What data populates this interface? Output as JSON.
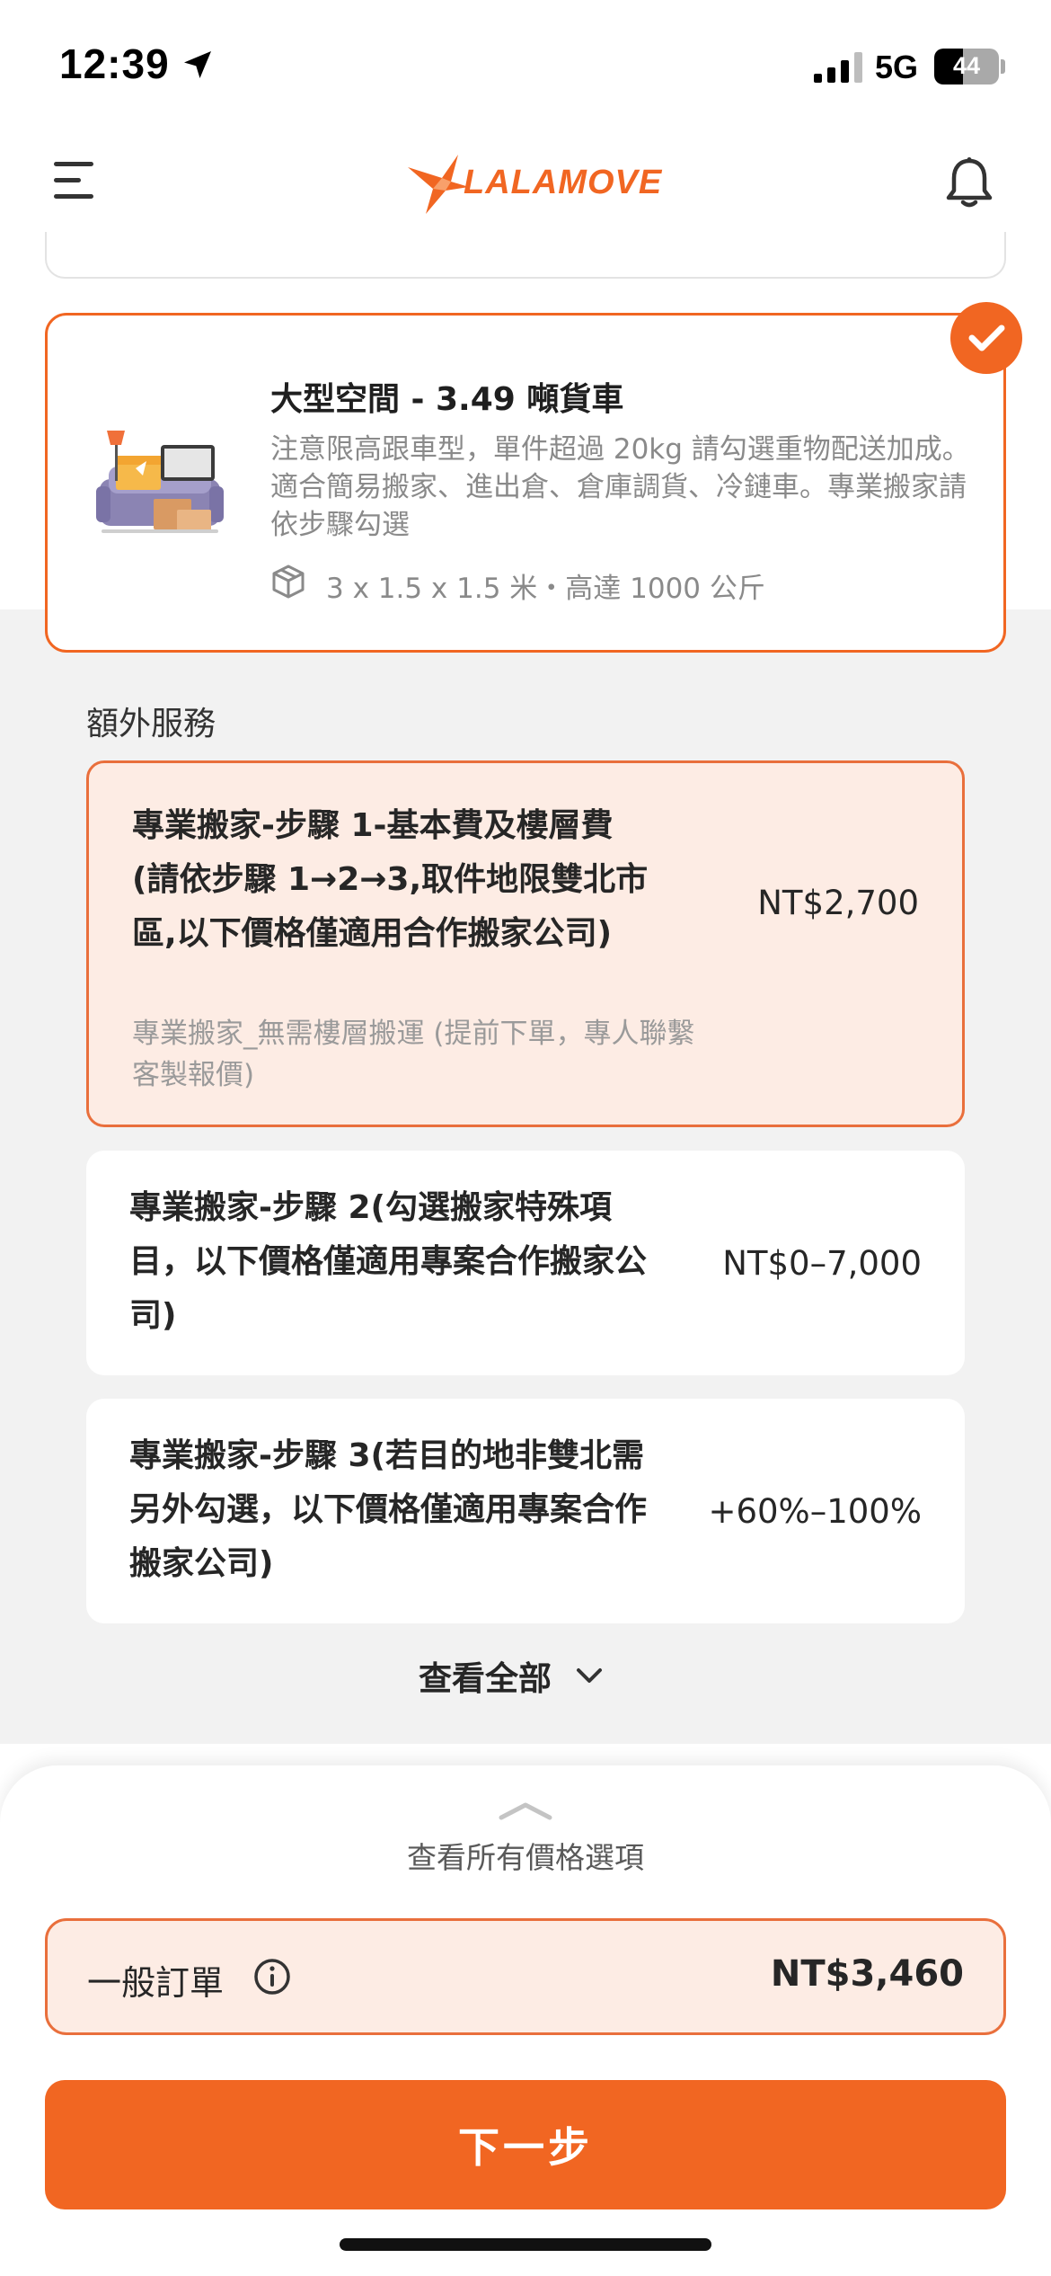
{
  "status_bar": {
    "time": "12:39",
    "network": "5G",
    "battery": "44",
    "battery_level_percent": 44
  },
  "header": {
    "brand": "LALAMOVE",
    "brand_color": "#f16622",
    "icons": [
      "menu-icon",
      "bell-icon"
    ]
  },
  "vehicle": {
    "title": "大型空間 - 3.49 噸貨車",
    "description": "注意限高跟車型，單件超過 20kg 請勾選重物配送加成。適合簡易搬家、進出倉、倉庫調貨、冷鏈車。專業搬家請依步驟勾選",
    "spec": "3 x 1.5 x 1.5 米・高達 1000 公斤",
    "selected": true
  },
  "extra_services": {
    "heading": "額外服務",
    "items": [
      {
        "title": "專業搬家-步驟 1-基本費及樓層費 (請依步驟 1→2→3,取件地限雙北市區,以下價格僅適用合作搬家公司)",
        "subtitle": "專業搬家_無需樓層搬運 (提前下單，專人聯繫客製報價)",
        "price": "NT$2,700",
        "selected": true
      },
      {
        "title": "專業搬家-步驟 2(勾選搬家特殊項目，以下價格僅適用專案合作搬家公司)",
        "price": "NT$0–7,000",
        "selected": false
      },
      {
        "title": "專業搬家-步驟 3(若目的地非雙北需另外勾選，以下價格僅適用專案合作搬家公司)",
        "price": "+60%–100%",
        "selected": false
      }
    ],
    "view_all": "查看全部"
  },
  "bottom_sheet": {
    "view_all_prices": "查看所有價格選項",
    "order_type": "一般訂單",
    "order_price": "NT$3,460",
    "next_button": "下一步"
  }
}
